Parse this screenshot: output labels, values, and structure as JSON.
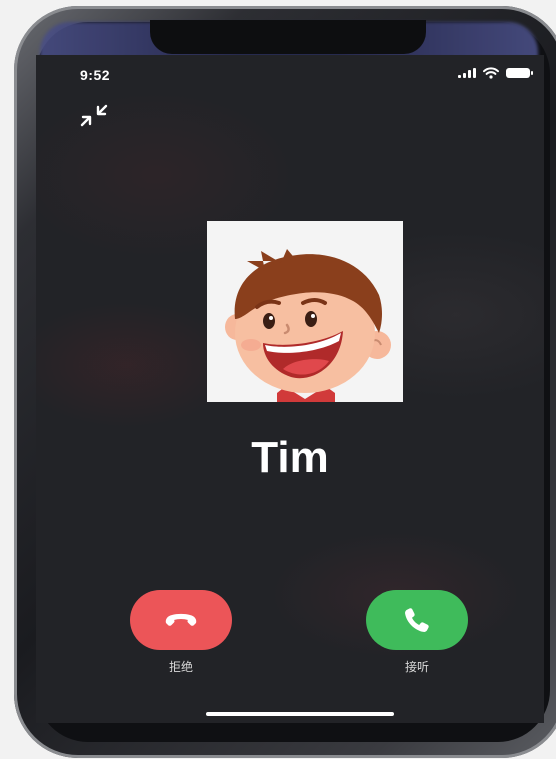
{
  "status_bar": {
    "time": "9:52",
    "icons": [
      "cellular-signal-icon",
      "wifi-icon",
      "battery-icon"
    ]
  },
  "controls": {
    "collapse_icon": "collapse-arrows-icon"
  },
  "caller": {
    "name": "Tim",
    "avatar": "cartoon-boy-avatar"
  },
  "actions": {
    "decline_label": "拒绝",
    "accept_label": "接听",
    "decline_color": "#ec5558",
    "accept_color": "#3fbb5b"
  },
  "theme": {
    "screen_background": "#222327"
  }
}
